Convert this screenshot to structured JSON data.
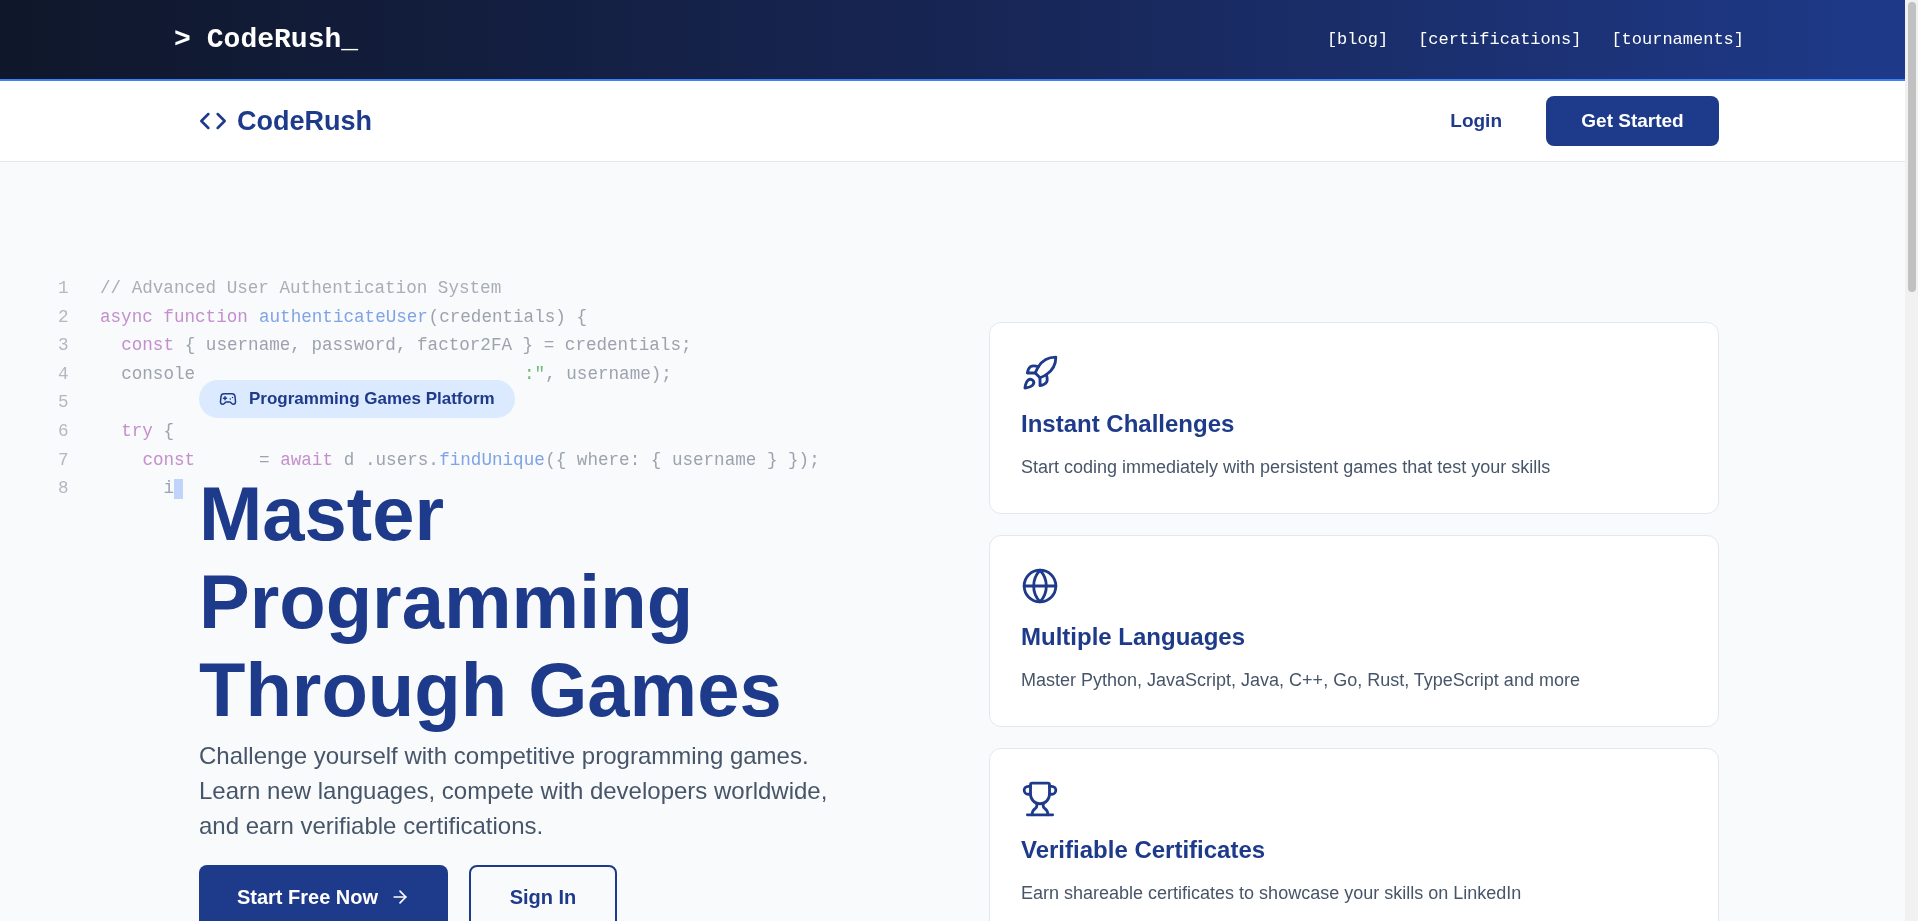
{
  "top_bar": {
    "logo_prompt": ">",
    "logo": "CodeRush_",
    "links": [
      {
        "label": "[blog]"
      },
      {
        "label": "[certifications]"
      },
      {
        "label": "[tournaments]"
      }
    ]
  },
  "nav": {
    "brand": "CodeRush",
    "login": "Login",
    "cta": "Get Started"
  },
  "code_background": {
    "lines": [
      {
        "number": "1",
        "segments": [
          {
            "kind": "comment",
            "text": "// Advanced User Authentication System"
          }
        ]
      },
      {
        "number": "2",
        "segments": [
          {
            "kind": "keyword",
            "text": "async function "
          },
          {
            "kind": "function",
            "text": "authenticateUser"
          },
          {
            "kind": "plain",
            "text": "(credentials) {"
          }
        ]
      },
      {
        "number": "3",
        "segments": [
          {
            "kind": "keyword",
            "text": "const"
          },
          {
            "kind": "plain",
            "text": " { username, password, factor2FA } = credentials;"
          }
        ]
      },
      {
        "number": "4",
        "segments": [
          {
            "kind": "plain",
            "text": "console"
          },
          {
            "kind": "string",
            "text": ":\""
          },
          {
            "kind": "plain",
            "text": ", username);"
          }
        ]
      },
      {
        "number": "5"
      },
      {
        "number": "6",
        "segments": [
          {
            "kind": "keyword",
            "text": "try"
          },
          {
            "kind": "plain",
            "text": " {"
          }
        ]
      },
      {
        "number": "7",
        "segments": [
          {
            "kind": "keyword",
            "text": "const"
          },
          {
            "kind": "plain",
            "text": "= "
          },
          {
            "kind": "keyword",
            "text": "await"
          },
          {
            "kind": "plain",
            "text": " d"
          },
          {
            "kind": "plain",
            "text": ".users."
          },
          {
            "kind": "function",
            "text": "findUnique"
          },
          {
            "kind": "plain",
            "text": "({ where: { username } });"
          }
        ]
      },
      {
        "number": "8",
        "segments": [
          {
            "kind": "plain",
            "text": "i"
          },
          {
            "kind": "cursor"
          }
        ]
      }
    ]
  },
  "hero": {
    "badge": "Programming Games Platform",
    "title": [
      "Master",
      "Programming",
      "Through Games"
    ],
    "description": "Challenge yourself with competitive programming games. Learn new languages, compete with developers worldwide, and earn verifiable certifications.",
    "buttons": [
      {
        "kind": "primary",
        "label": "Start Free Now"
      },
      {
        "kind": "outline",
        "label": "Sign In"
      }
    ]
  },
  "features": [
    {
      "title": "Instant Challenges",
      "description": "Start coding immediately with persistent games that test your skills"
    },
    {
      "title": "Multiple Languages",
      "description": "Master Python, JavaScript, Java, C++, Go, Rust, TypeScript and more"
    },
    {
      "title": "Verifiable Certificates",
      "description": "Earn shareable certificates to showcase your skills on LinkedIn"
    }
  ]
}
